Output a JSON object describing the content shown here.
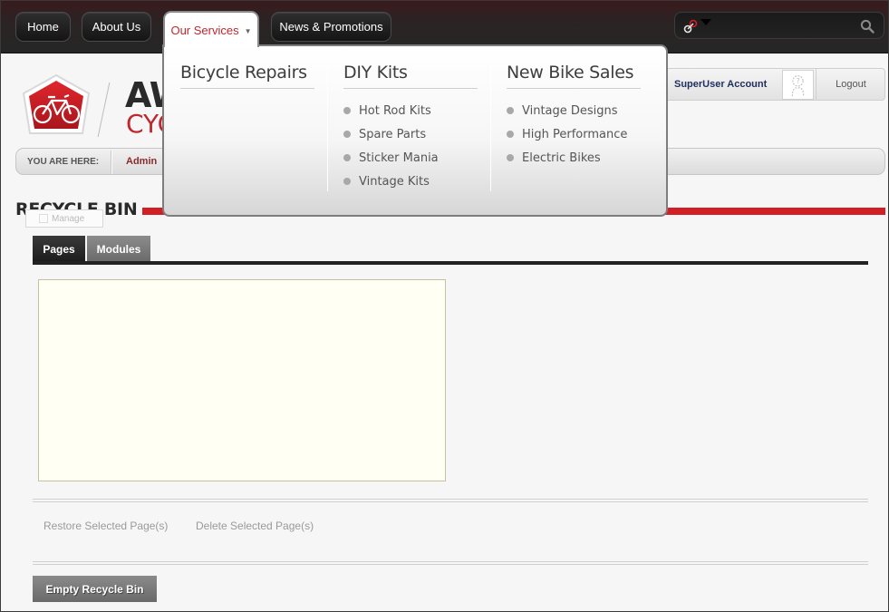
{
  "nav": {
    "items": [
      {
        "label": "Home"
      },
      {
        "label": "About Us"
      },
      {
        "label": "Our Services",
        "caret": "▼"
      },
      {
        "label": "News & Promotions"
      }
    ]
  },
  "search": {
    "value": "",
    "placeholder": ""
  },
  "brand": {
    "line1": "AW",
    "line2": "CYC"
  },
  "user": {
    "account_label": "SuperUser Account",
    "logout_label": "Logout"
  },
  "breadcrumb": {
    "label": "YOU ARE HERE:",
    "current": "Admin"
  },
  "page": {
    "title": "RECYCLE BIN",
    "manage_label": "Manage",
    "tabs": [
      {
        "label": "Pages",
        "active": true
      },
      {
        "label": "Modules",
        "active": false
      }
    ],
    "actions": {
      "restore": "Restore Selected Page(s)",
      "delete": "Delete Selected Page(s)",
      "empty": "Empty Recycle Bin"
    }
  },
  "mega_menu": {
    "columns": [
      {
        "heading": "Bicycle Repairs",
        "items": []
      },
      {
        "heading": "DIY Kits",
        "items": [
          "Hot Rod Kits",
          "Spare Parts",
          "Sticker Mania",
          "Vintage Kits"
        ]
      },
      {
        "heading": "New Bike Sales",
        "items": [
          "Vintage Designs",
          "High Performance",
          "Electric Bikes"
        ]
      }
    ]
  },
  "colors": {
    "accent": "#d21f26",
    "brand_red": "#c0272d",
    "dark": "#1c1c1c"
  },
  "icons": [
    "search-scope-icon",
    "search-icon",
    "logo-bicycle-icon",
    "avatar-placeholder-icon",
    "manage-icon"
  ]
}
